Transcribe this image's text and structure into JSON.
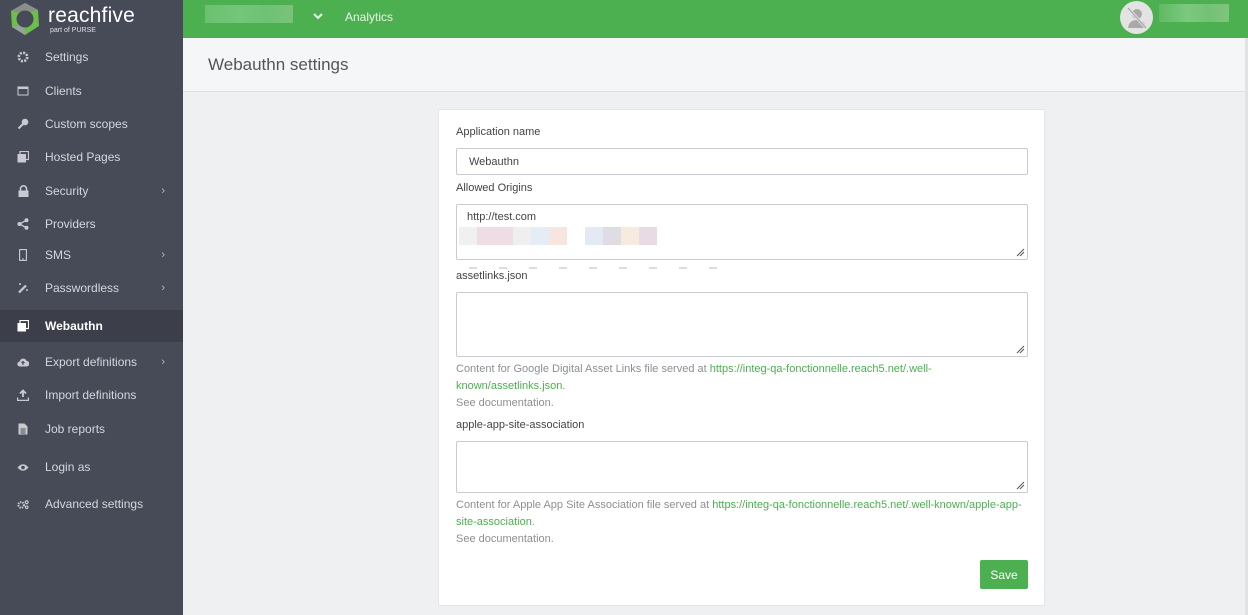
{
  "brand": {
    "name": "reachfive",
    "tagline": "part of PURSE",
    "accent_color": "#4caf50",
    "sidebar_color": "#474a57"
  },
  "topbar": {
    "dropdown_icon": "chevron-down-icon",
    "analytics_label": "Analytics",
    "avatar_icon": "user-slash-avatar-icon"
  },
  "sidebar": {
    "items": [
      {
        "label": "Settings",
        "icon": "gear-icon",
        "has_submenu": false,
        "active": false
      },
      {
        "label": "Clients",
        "icon": "window-icon",
        "has_submenu": false,
        "active": false
      },
      {
        "label": "Custom scopes",
        "icon": "key-icon",
        "has_submenu": false,
        "active": false
      },
      {
        "label": "Hosted Pages",
        "icon": "pages-icon",
        "has_submenu": false,
        "active": false
      },
      {
        "label": "Security",
        "icon": "lock-icon",
        "has_submenu": true,
        "active": false
      },
      {
        "label": "Providers",
        "icon": "share-icon",
        "has_submenu": false,
        "active": false
      },
      {
        "label": "SMS",
        "icon": "mobile-icon",
        "has_submenu": true,
        "active": false
      },
      {
        "label": "Passwordless",
        "icon": "magic-wand-icon",
        "has_submenu": true,
        "active": false
      },
      {
        "label": "Webauthn",
        "icon": "pages-icon",
        "has_submenu": false,
        "active": true
      },
      {
        "label": "Export definitions",
        "icon": "cloud-upload-icon",
        "has_submenu": true,
        "active": false
      },
      {
        "label": "Import definitions",
        "icon": "upload-icon",
        "has_submenu": false,
        "active": false
      },
      {
        "label": "Job reports",
        "icon": "file-icon",
        "has_submenu": false,
        "active": false
      },
      {
        "label": "Login as",
        "icon": "eye-icon",
        "has_submenu": false,
        "active": false
      },
      {
        "label": "Advanced settings",
        "icon": "gears-icon",
        "has_submenu": false,
        "active": false
      }
    ]
  },
  "page": {
    "title": "Webauthn settings"
  },
  "form": {
    "app_name_label": "Application name",
    "app_name_value": "Webauthn",
    "origins_label": "Allowed Origins",
    "origins_value": "http://test.com",
    "assetlinks_label": "assetlinks.json",
    "assetlinks_value": "",
    "assetlinks_help_prefix": "Content for Google Digital Asset Links file served at ",
    "assetlinks_help_link": "https://integ-qa-fonctionnelle.reach5.net/.well-known/assetlinks.json",
    "assetlinks_help_suffix": ".",
    "assetlinks_doc": "See documentation.",
    "aasa_label": "apple-app-site-association",
    "aasa_value": "",
    "aasa_help_prefix": "Content for Apple App Site Association file served at ",
    "aasa_help_link": "https://integ-qa-fonctionnelle.reach5.net/.well-known/apple-app-site-association",
    "aasa_help_suffix": ".",
    "aasa_doc": "See documentation.",
    "save_label": "Save"
  }
}
